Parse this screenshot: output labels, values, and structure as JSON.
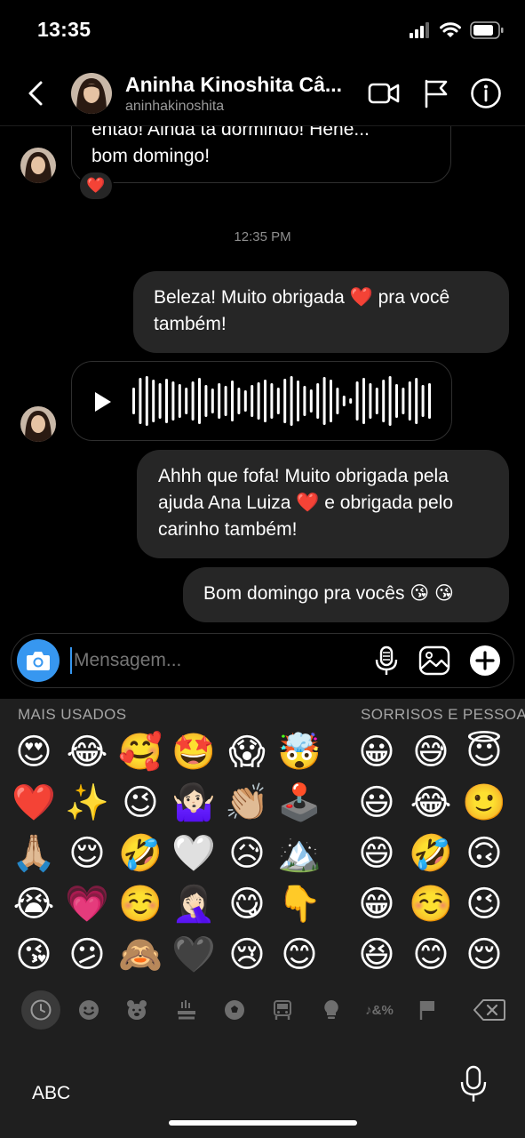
{
  "status_bar": {
    "time": "13:35"
  },
  "header": {
    "name": "Aninha Kinoshita Câ...",
    "username": "aninhakinoshita"
  },
  "chat": {
    "messages": [
      {
        "sender": "them",
        "text_line1": "então! Ainda tá dormindo! Hehe...",
        "text_line2": "bom domingo!",
        "reaction": "❤️"
      },
      {
        "timestamp": "12:35 PM"
      },
      {
        "sender": "me",
        "line1": "Beleza! Muito obrigada ❤️  pra você",
        "line2": "também!"
      },
      {
        "sender": "them",
        "type": "audio"
      },
      {
        "sender": "me",
        "line1": "Ahhh que fofa! Muito obrigada pela",
        "line2": "ajuda Ana Luiza ❤️  e obrigada pelo",
        "line3": "carinho também!"
      },
      {
        "sender": "me",
        "line1": "Bom domingo pra vocês 😘 😘"
      }
    ]
  },
  "composer": {
    "placeholder": "Mensagem..."
  },
  "keyboard": {
    "section_frequent": "MAIS USADOS",
    "section_smileys": "SORRISOS E PESSOAS",
    "frequent_emojis": [
      [
        "😍",
        "😂",
        "🥰",
        "🤩",
        "😱",
        "🤯"
      ],
      [
        "❤️",
        "✨",
        "😉",
        "🤷🏻‍♀️",
        "👏🏼",
        "🕹️"
      ],
      [
        "🙏🏼",
        "😌",
        "🤣",
        "🤍",
        "😥",
        "🏔️"
      ],
      [
        "😭",
        "💗",
        "☺️",
        "🤦🏻‍♀️",
        "😋",
        "👇"
      ],
      [
        "😘",
        "😕",
        "🙈",
        "🖤",
        "😢",
        "😊"
      ]
    ],
    "smiley_emojis": [
      [
        "😀",
        "😅",
        "😇"
      ],
      [
        "😃",
        "😂",
        "🙂"
      ],
      [
        "😄",
        "🤣",
        "🙃"
      ],
      [
        "😁",
        "☺️",
        "😉"
      ],
      [
        "😆",
        "😊",
        "😌"
      ]
    ],
    "categories": [
      "clock-icon",
      "smiley-icon",
      "animal-icon",
      "food-icon",
      "ball-icon",
      "car-icon",
      "bulb-icon",
      "symbols-icon",
      "flag-icon"
    ],
    "symbols_label": "♪&%",
    "abc_label": "ABC"
  },
  "colors": {
    "accent": "#3797f0",
    "bubble_out": "#262626",
    "keyboard_bg": "#1f1f1f"
  }
}
